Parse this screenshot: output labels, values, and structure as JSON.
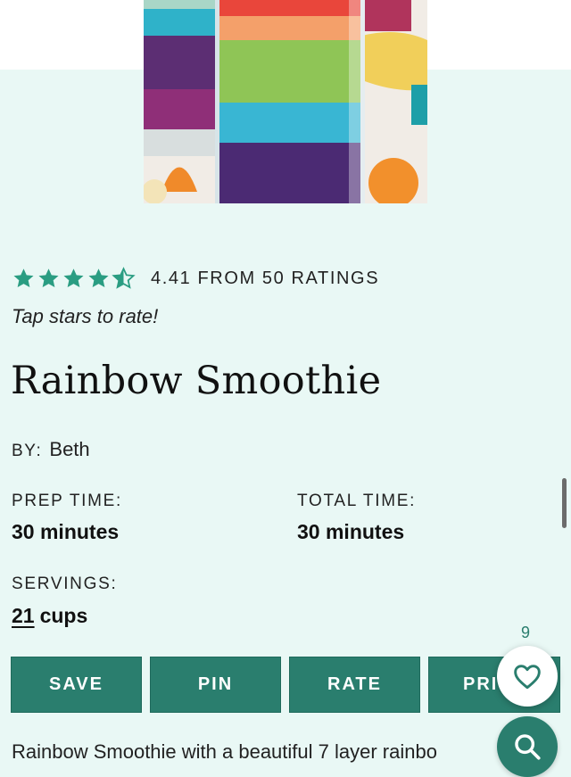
{
  "rating": {
    "value": 4.41,
    "text": "4.41 FROM 50 RATINGS",
    "prompt": "Tap stars to rate!",
    "star_color": "#2a9d82"
  },
  "recipe": {
    "title": "Rainbow Smoothie",
    "by_label": "BY:",
    "author": "Beth",
    "prep_label": "PREP TIME:",
    "prep_value": "30 minutes",
    "total_label": "TOTAL TIME:",
    "total_value": "30 minutes",
    "servings_label": "SERVINGS:",
    "servings_num": "21",
    "servings_unit": "cups",
    "intro": "Rainbow Smoothie with a beautiful 7 layer rainbo"
  },
  "actions": {
    "save": "SAVE",
    "pin": "PIN",
    "rate": "RATE",
    "print": "PRI"
  },
  "favorites": {
    "count": "9",
    "icon": "heart-icon"
  },
  "search": {
    "icon": "search-icon"
  },
  "colors": {
    "accent": "#2a7e6e",
    "background": "#e9f8f5"
  }
}
